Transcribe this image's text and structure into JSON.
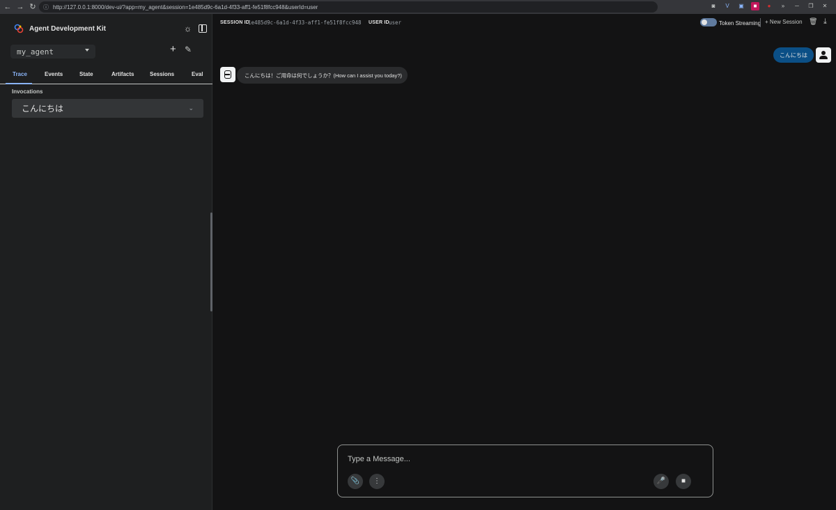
{
  "browser": {
    "url": "http://127.0.0.1:8000/dev-ui/?app=my_agent&session=1e485d9c-6a1d-4f33-aff1-fe51f8fcc948&userId=user"
  },
  "sidebar": {
    "title": "Agent Development Kit",
    "agent": "my_agent",
    "tabs": [
      {
        "label": "Trace"
      },
      {
        "label": "Events"
      },
      {
        "label": "State"
      },
      {
        "label": "Artifacts"
      },
      {
        "label": "Sessions"
      },
      {
        "label": "Eval"
      }
    ],
    "active_tab": "Trace",
    "invocations_label": "Invocations",
    "invocations": [
      {
        "label": "こんにちは"
      }
    ]
  },
  "topbar": {
    "session_id_label": "SESSION ID",
    "session_id": "1e485d9c-6a1d-4f33-aff1-fe51f8fcc948",
    "user_id_label": "USER ID",
    "user_id": "user",
    "token_streaming_label": "Token Streaming",
    "new_session_label": "New Session"
  },
  "chat": {
    "messages": [
      {
        "role": "user",
        "text": "こんにちは"
      },
      {
        "role": "agent",
        "text": "こんにちは！ご用命は何でしょうか？(How can I assist you today?)"
      }
    ]
  },
  "composer": {
    "placeholder": "Type a Message..."
  },
  "colors": {
    "background": "#131314",
    "sidebar": "#1e1f20",
    "accent": "#8ab4f8",
    "user_bubble": "#0b4f86"
  }
}
